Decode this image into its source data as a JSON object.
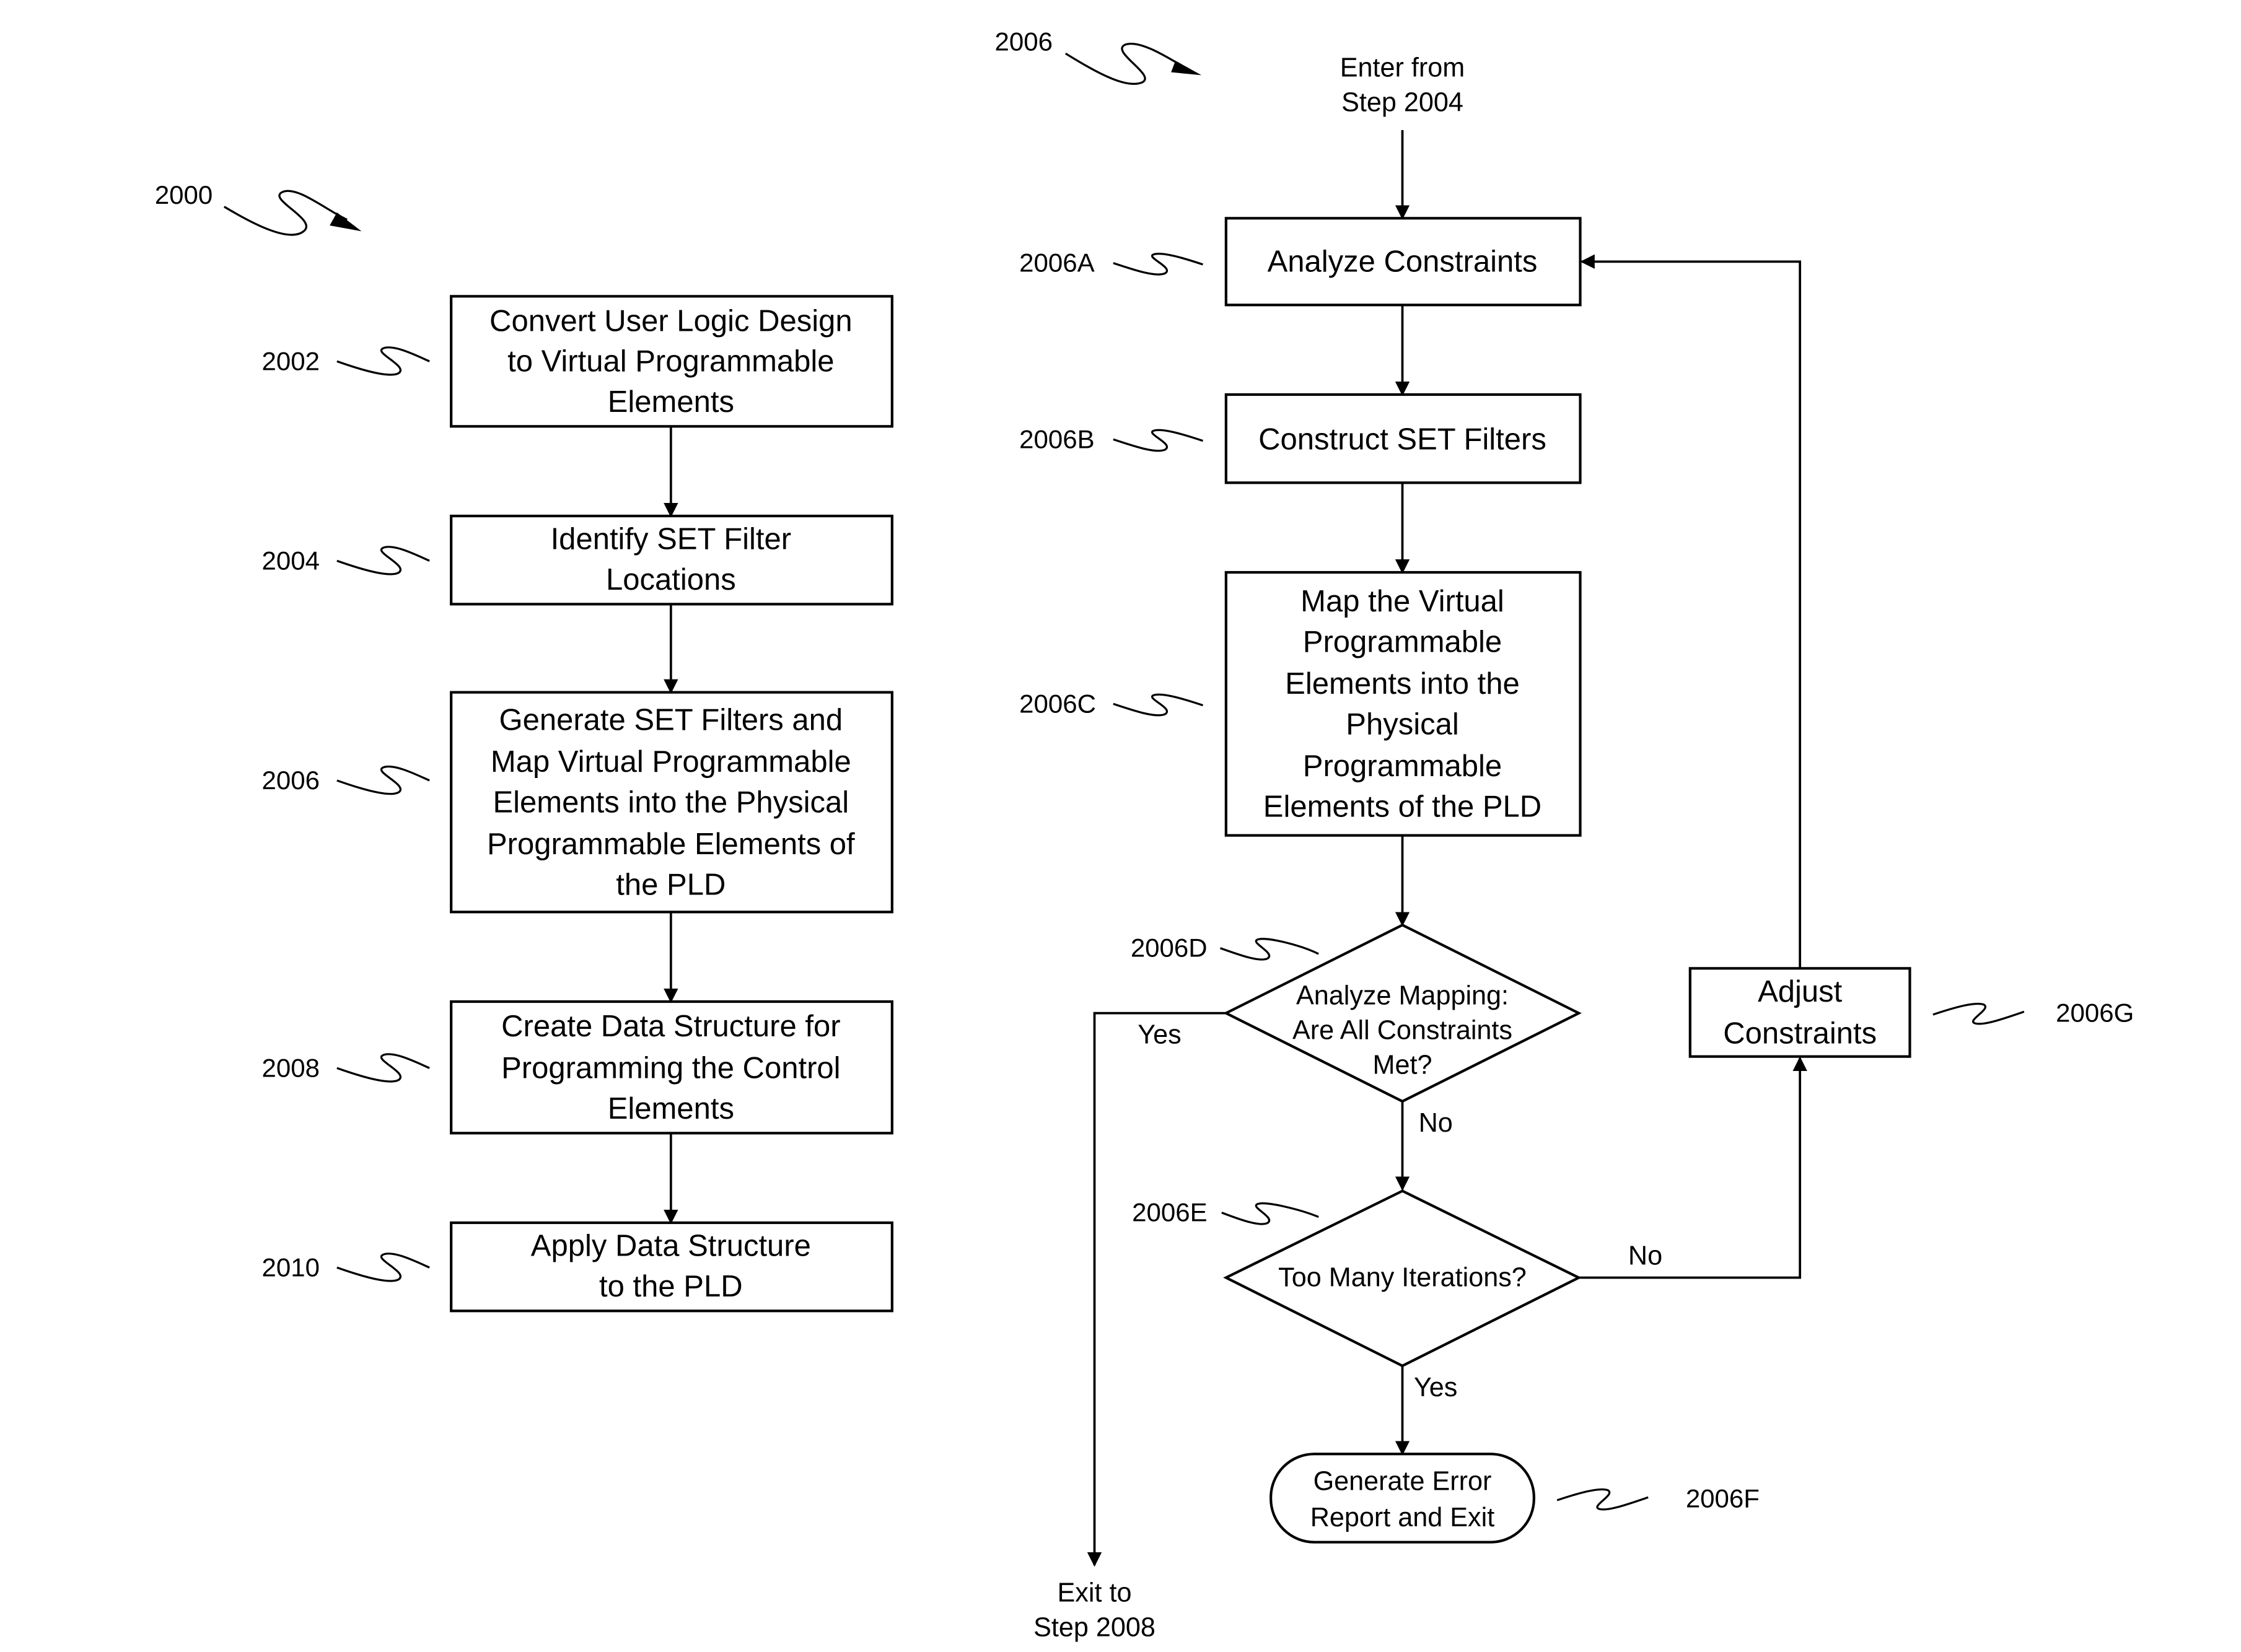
{
  "figure": {
    "left_flow": {
      "ref": "2000",
      "steps": [
        {
          "ref": "2002",
          "lines": [
            "Convert User Logic Design",
            "to Virtual Programmable",
            "Elements"
          ]
        },
        {
          "ref": "2004",
          "lines": [
            "Identify SET Filter",
            "Locations"
          ]
        },
        {
          "ref": "2006",
          "lines": [
            "Generate SET Filters and",
            "Map Virtual Programmable",
            "Elements into the Physical",
            "Programmable Elements of",
            "the PLD"
          ]
        },
        {
          "ref": "2008",
          "lines": [
            "Create Data Structure for",
            "Programming the Control",
            "Elements"
          ]
        },
        {
          "ref": "2010",
          "lines": [
            "Apply Data Structure",
            "to the PLD"
          ]
        }
      ]
    },
    "right_flow": {
      "ref": "2006",
      "entry": [
        "Enter from",
        "Step 2004"
      ],
      "steps": {
        "a": {
          "ref": "2006A",
          "lines": [
            "Analyze Constraints"
          ]
        },
        "b": {
          "ref": "2006B",
          "lines": [
            "Construct SET Filters"
          ]
        },
        "c": {
          "ref": "2006C",
          "lines": [
            "Map the Virtual",
            "Programmable",
            "Elements into the",
            "Physical",
            "Programmable",
            "Elements of the PLD"
          ]
        },
        "d": {
          "ref": "2006D",
          "lines": [
            "Analyze Mapping:",
            "Are All Constraints",
            "Met?"
          ]
        },
        "e": {
          "ref": "2006E",
          "lines": [
            "Too Many Iterations?"
          ]
        },
        "f": {
          "ref": "2006F",
          "lines": [
            "Generate Error",
            "Report and Exit"
          ]
        },
        "g": {
          "ref": "2006G",
          "lines": [
            "Adjust",
            "Constraints"
          ]
        }
      },
      "edge_labels": {
        "d_yes": "Yes",
        "d_no": "No",
        "e_no": "No",
        "e_yes": "Yes"
      },
      "exit": [
        "Exit to",
        "Step 2008"
      ]
    }
  }
}
